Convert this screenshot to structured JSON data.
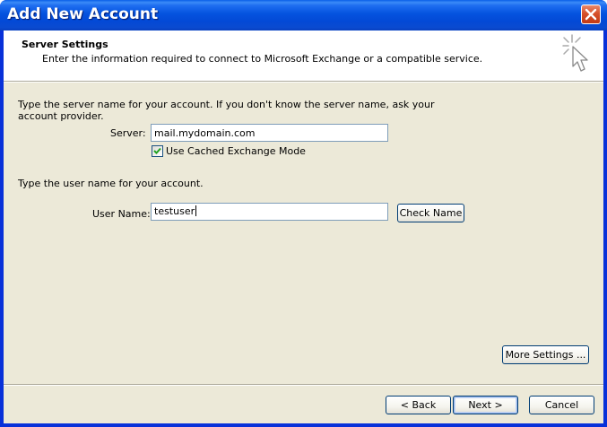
{
  "window": {
    "title": "Add New Account",
    "close_icon": "close-x-icon"
  },
  "header": {
    "title": "Server Settings",
    "subtitle": "Enter the information required to connect to Microsoft Exchange or a compatible service.",
    "icon": "wizard-sparkle-cursor-icon"
  },
  "server_section": {
    "instruction_line1": "Type the server name for your account. If you don't know the server name, ask your",
    "instruction_line2": "account provider.",
    "server_label": "Server:",
    "server_value": "mail.mydomain.com",
    "cached_mode_label": "Use Cached Exchange Mode",
    "cached_mode_checked": true
  },
  "user_section": {
    "instruction": "Type the user name for your account.",
    "username_label": "User Name:",
    "username_value": "testuser",
    "check_name_label": "Check Name"
  },
  "buttons": {
    "more_settings": "More Settings ...",
    "back": "< Back",
    "next": "Next >",
    "cancel": "Cancel"
  },
  "colors": {
    "titlebar": "#0453df",
    "client_bg": "#ece9d8",
    "close_button": "#d6502a",
    "field_border": "#7f9db9"
  }
}
